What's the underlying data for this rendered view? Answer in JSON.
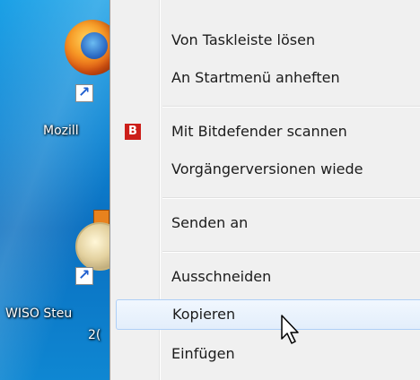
{
  "desktop": {
    "icons": [
      {
        "label": "Mozill"
      },
      {
        "label_line1": "WISO Steu",
        "label_line2": "2("
      }
    ]
  },
  "menu": {
    "items": [
      {
        "label": "Von Taskleiste lösen"
      },
      {
        "label": "An Startmenü anheften"
      },
      {
        "label": "Mit Bitdefender scannen",
        "icon": "bitdefender-icon",
        "icon_text": "B"
      },
      {
        "label": "Vorgängerversionen wiede"
      },
      {
        "label": "Senden an"
      },
      {
        "label": "Ausschneiden"
      },
      {
        "label": "Kopieren",
        "state": "hover"
      },
      {
        "label": "Einfügen"
      }
    ]
  },
  "colors": {
    "menu_bg": "#f0f0f0",
    "hover_border": "#aecff7",
    "bitdefender_red": "#cc1f1a",
    "desktop_blue": "#0f86d4"
  }
}
